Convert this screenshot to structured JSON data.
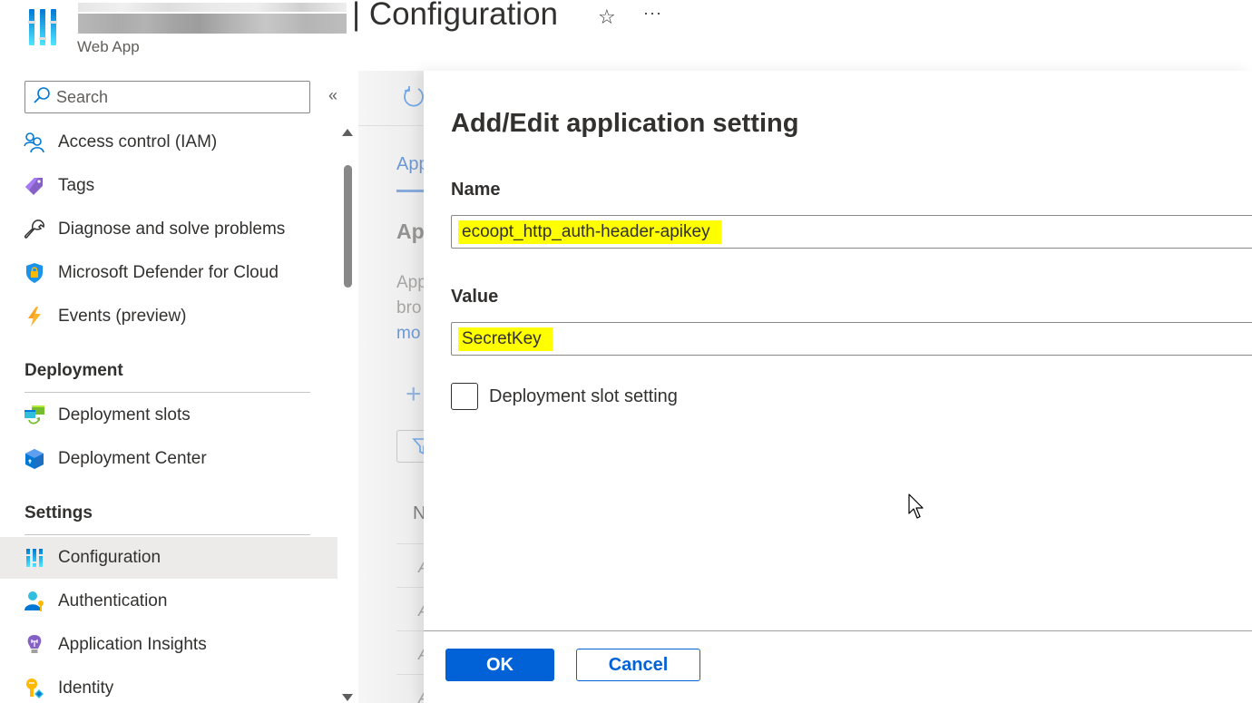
{
  "header": {
    "resource_name_redacted": true,
    "title": "| Configuration",
    "subtitle": "Web App",
    "favorite_icon": "star-icon",
    "more_icon": "ellipsis-icon",
    "star_glyph": "☆",
    "more_glyph": "···"
  },
  "sidebar": {
    "search_placeholder": "Search",
    "collapse_glyph": "«",
    "items_top": [
      {
        "label": "Access control (IAM)",
        "icon": "people-icon"
      },
      {
        "label": "Tags",
        "icon": "tag-icon"
      },
      {
        "label": "Diagnose and solve problems",
        "icon": "wrench-icon"
      },
      {
        "label": "Microsoft Defender for Cloud",
        "icon": "shield-lock-icon"
      },
      {
        "label": "Events (preview)",
        "icon": "lightning-icon"
      }
    ],
    "sections": [
      {
        "title": "Deployment",
        "items": [
          {
            "label": "Deployment slots",
            "icon": "deployment-slots-icon"
          },
          {
            "label": "Deployment Center",
            "icon": "cube-icon"
          }
        ]
      },
      {
        "title": "Settings",
        "items": [
          {
            "label": "Configuration",
            "icon": "sliders-icon",
            "active": true
          },
          {
            "label": "Authentication",
            "icon": "user-key-icon"
          },
          {
            "label": "Application Insights",
            "icon": "lightbulb-icon"
          },
          {
            "label": "Identity",
            "icon": "key-identity-icon"
          }
        ]
      }
    ]
  },
  "background_blade": {
    "tab_partial": "App",
    "heading_partial": "Ap",
    "desc_lines": [
      "App",
      "bro"
    ],
    "link_partial": "mo",
    "column_header_partial": "N",
    "row_partials": [
      "A",
      "A",
      "A",
      "A"
    ],
    "plus_glyph": "+"
  },
  "dialog": {
    "title": "Add/Edit application setting",
    "name_label": "Name",
    "name_value": "ecoopt_http_auth-header-apikey",
    "value_label": "Value",
    "value_value": "SecretKey",
    "highlight_color": "#ffff00",
    "slot_setting_label": "Deployment slot setting",
    "slot_setting_checked": false,
    "ok_label": "OK",
    "cancel_label": "Cancel"
  },
  "colors": {
    "primary": "#0062d6",
    "active_nav_bg": "#edebe9"
  }
}
